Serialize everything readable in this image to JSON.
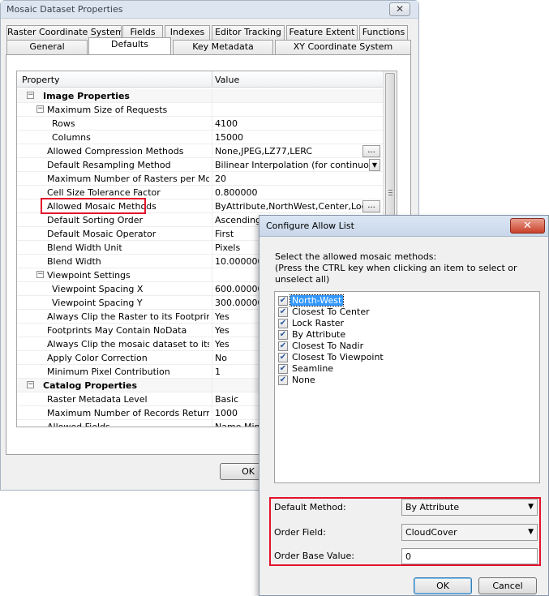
{
  "window": {
    "title": "Mosaic Dataset Properties",
    "close": "✕"
  },
  "tabs_top": [
    "Raster Coordinate System",
    "Fields",
    "Indexes",
    "Editor Tracking",
    "Feature Extent",
    "Functions"
  ],
  "tabs_bottom": [
    "General",
    "Defaults",
    "Key Metadata",
    "XY Coordinate System"
  ],
  "active_tab": "Defaults",
  "grid": {
    "col_property": "Property",
    "col_value": "Value",
    "rows": [
      {
        "indent": 0,
        "exp": "−",
        "p": "Image Properties",
        "v": "",
        "cat": true
      },
      {
        "indent": 1,
        "exp": "−",
        "p": "Maximum Size of Requests",
        "v": ""
      },
      {
        "indent": 2,
        "exp": "",
        "p": "Rows",
        "v": "4100"
      },
      {
        "indent": 2,
        "exp": "",
        "p": "Columns",
        "v": "15000"
      },
      {
        "indent": 1,
        "exp": "",
        "p": "Allowed Compression Methods",
        "v": "None,JPEG,LZ77,LERC",
        "btn": "ellipsis"
      },
      {
        "indent": 1,
        "exp": "",
        "p": "Default Resampling Method",
        "v": "Bilinear Interpolation (for continuous d…",
        "btn": "dropdown"
      },
      {
        "indent": 1,
        "exp": "",
        "p": "Maximum Number of Rasters per Mosaic",
        "v": "20"
      },
      {
        "indent": 1,
        "exp": "",
        "p": "Cell Size Tolerance Factor",
        "v": "0.800000"
      },
      {
        "indent": 1,
        "exp": "",
        "p": "Allowed Mosaic Methods",
        "v": "ByAttribute,NorthWest,Center,LockRa…",
        "btn": "ellipsis"
      },
      {
        "indent": 1,
        "exp": "",
        "p": "Default Sorting Order",
        "v": "Ascending"
      },
      {
        "indent": 1,
        "exp": "",
        "p": "Default Mosaic Operator",
        "v": "First"
      },
      {
        "indent": 1,
        "exp": "",
        "p": "Blend Width Unit",
        "v": "Pixels"
      },
      {
        "indent": 1,
        "exp": "",
        "p": "Blend Width",
        "v": "10.000000"
      },
      {
        "indent": 1,
        "exp": "−",
        "p": "Viewpoint Settings",
        "v": ""
      },
      {
        "indent": 2,
        "exp": "",
        "p": "Viewpoint Spacing X",
        "v": "600.000000"
      },
      {
        "indent": 2,
        "exp": "",
        "p": "Viewpoint Spacing Y",
        "v": "300.000000"
      },
      {
        "indent": 1,
        "exp": "",
        "p": "Always Clip the Raster to its Footprint",
        "v": "Yes"
      },
      {
        "indent": 1,
        "exp": "",
        "p": "Footprints May Contain NoData",
        "v": "Yes"
      },
      {
        "indent": 1,
        "exp": "",
        "p": "Always Clip the mosaic dataset to its B…",
        "v": "Yes"
      },
      {
        "indent": 1,
        "exp": "",
        "p": "Apply Color Correction",
        "v": "No"
      },
      {
        "indent": 1,
        "exp": "",
        "p": "Minimum Pixel Contribution",
        "v": "1"
      },
      {
        "indent": 0,
        "exp": "−",
        "p": "Catalog Properties",
        "v": "",
        "cat": true
      },
      {
        "indent": 1,
        "exp": "",
        "p": "Raster Metadata Level",
        "v": "Basic"
      },
      {
        "indent": 1,
        "exp": "",
        "p": "Maximum Number of Records Returned…",
        "v": "1000"
      },
      {
        "indent": 1,
        "exp": "",
        "p": "Allowed Fields",
        "v": "Name,MinP…"
      }
    ],
    "ellipsis_label": "...",
    "dropdown_arrow": "▼"
  },
  "main_ok": "OK",
  "dialog": {
    "title": "Configure Allow List",
    "close": "✕",
    "instruction_1": "Select the allowed mosaic methods:",
    "instruction_2": "(Press the CTRL key when clicking an item to select or unselect all)",
    "items": [
      {
        "label": "North-West",
        "checked": true,
        "selected": true
      },
      {
        "label": "Closest To Center",
        "checked": true
      },
      {
        "label": "Lock Raster",
        "checked": true
      },
      {
        "label": "By Attribute",
        "checked": true
      },
      {
        "label": "Closest To Nadir",
        "checked": true
      },
      {
        "label": "Closest To Viewpoint",
        "checked": true
      },
      {
        "label": "Seamline",
        "checked": true
      },
      {
        "label": "None",
        "checked": true
      }
    ],
    "default_method_label": "Default Method:",
    "default_method_value": "By Attribute",
    "order_field_label": "Order Field:",
    "order_field_value": "CloudCover",
    "order_base_label": "Order Base Value:",
    "order_base_value": "0",
    "ok": "OK",
    "cancel": "Cancel"
  },
  "colors": {
    "highlight": "#e3132a",
    "selection": "#3399ff"
  }
}
